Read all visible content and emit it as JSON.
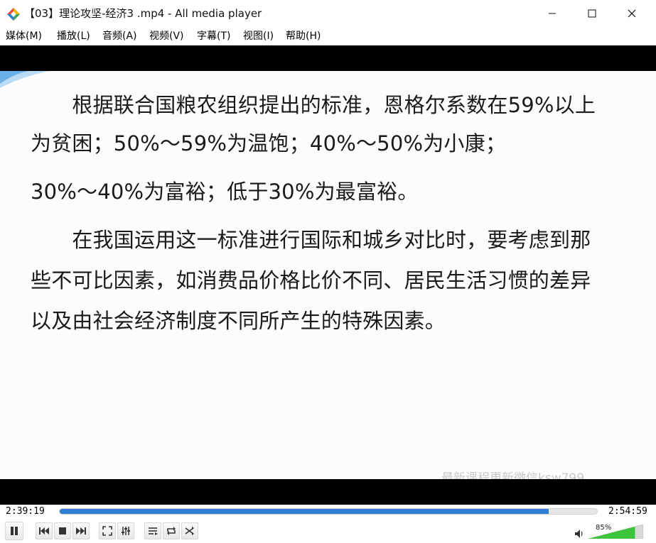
{
  "window": {
    "title": "【03】理论攻坚-经济3 .mp4 - All media player"
  },
  "menu": {
    "items": [
      {
        "label": "媒体(M)"
      },
      {
        "label": "播放(L)"
      },
      {
        "label": "音频(A)"
      },
      {
        "label": "视频(V)"
      },
      {
        "label": "字幕(T)"
      },
      {
        "label": "视图(I)"
      },
      {
        "label": "帮助(H)"
      }
    ]
  },
  "slide": {
    "lines": [
      "　　根据联合国粮农组织提出的标准，恩格尔系数在59%以上",
      "为贫困；50%～59%为温饱；40%～50%为小康；",
      "30%～40%为富裕；低于30%为最富裕。",
      "　　在我国运用这一标准进行国际和城乡对比时，要考虑到那",
      "些不可比因素，如消费品价格比价不同、居民生活习惯的差异",
      "以及由社会经济制度不同所产生的特殊因素。"
    ],
    "watermark": "最新课程更新微信ksw799"
  },
  "player": {
    "elapsed": "2:39:19",
    "duration": "2:54:59",
    "progress": 0.91,
    "volume_label": "85%",
    "volume": 0.85
  },
  "colors": {
    "progress_fill": "#2f7fd6",
    "volume_fill": "#3cc43c"
  },
  "icons": {
    "app": "all-media-player-icon",
    "pause": "pause-icon",
    "prev": "previous-icon",
    "stop": "stop-icon",
    "next": "next-icon",
    "fullscreen": "fullscreen-icon",
    "equalizer": "equalizer-icon",
    "playlist": "playlist-icon",
    "repeat": "repeat-icon",
    "shuffle": "shuffle-icon",
    "volume": "speaker-icon"
  }
}
